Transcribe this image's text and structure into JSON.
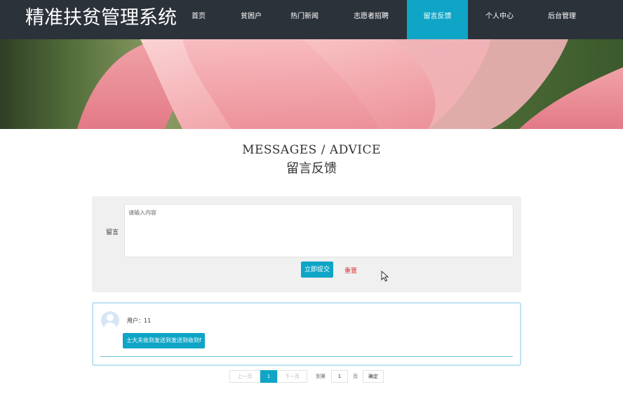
{
  "header": {
    "logo": "精准扶贫管理系统",
    "nav": [
      {
        "label": "首页",
        "active": false
      },
      {
        "label": "贫困户",
        "active": false
      },
      {
        "label": "热门新闻",
        "active": false
      },
      {
        "label": "志愿者招聘",
        "active": false
      },
      {
        "label": "留言反馈",
        "active": true
      },
      {
        "label": "个人中心",
        "active": false
      },
      {
        "label": "后台管理",
        "active": false
      }
    ],
    "active_color": "#0ea5c6"
  },
  "section": {
    "title_en": "MESSAGES / ADVICE",
    "title_cn": "留言反馈"
  },
  "form": {
    "label": "留言",
    "placeholder": "请输入内容",
    "submit_label": "立即提交",
    "reset_label": "重置"
  },
  "messages": [
    {
      "user_prefix": "用户：",
      "user": "11",
      "content": "士大夫收到发送到发送到收到f"
    }
  ],
  "pagination": {
    "prev_label": "上一页",
    "current_page": "1",
    "next_label": "下一页",
    "goto_prefix": "到第",
    "goto_value": "1",
    "goto_suffix": "页",
    "confirm_label": "确定"
  },
  "icons": {
    "avatar": "user-avatar-icon",
    "cursor": "mouse-pointer-icon"
  }
}
